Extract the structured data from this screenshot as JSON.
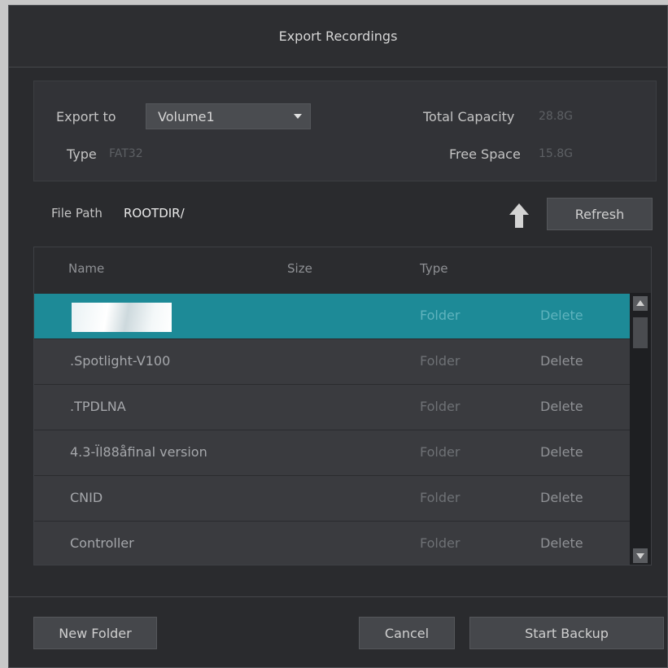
{
  "dialog": {
    "title": "Export Recordings"
  },
  "info": {
    "export_to_label": "Export to",
    "export_to_value": "Volume1",
    "type_label": "Type",
    "type_value": "FAT32",
    "total_capacity_label": "Total Capacity",
    "total_capacity_value": "28.8G",
    "free_space_label": "Free Space",
    "free_space_value": "15.8G"
  },
  "path": {
    "label": "File Path",
    "value": "ROOTDIR/",
    "up_icon": "up-arrow-icon",
    "refresh_label": "Refresh"
  },
  "table": {
    "columns": [
      "Name",
      "Size",
      "Type"
    ],
    "rows": [
      {
        "name": "",
        "type": "Folder",
        "action": "Delete",
        "selected": true
      },
      {
        "name": ".Spotlight-V100",
        "type": "Folder",
        "action": "Delete"
      },
      {
        "name": ".TPDLNA",
        "type": "Folder",
        "action": "Delete"
      },
      {
        "name": "4.3-Ïl88åfinal version",
        "type": "Folder",
        "action": "Delete"
      },
      {
        "name": "CNID",
        "type": "Folder",
        "action": "Delete"
      },
      {
        "name": "Controller",
        "type": "Folder",
        "action": "Delete"
      }
    ]
  },
  "footer": {
    "new_folder_label": "New Folder",
    "cancel_label": "Cancel",
    "start_backup_label": "Start Backup"
  },
  "colors": {
    "accent": "#1d8a97",
    "background": "#2a2b2e"
  }
}
